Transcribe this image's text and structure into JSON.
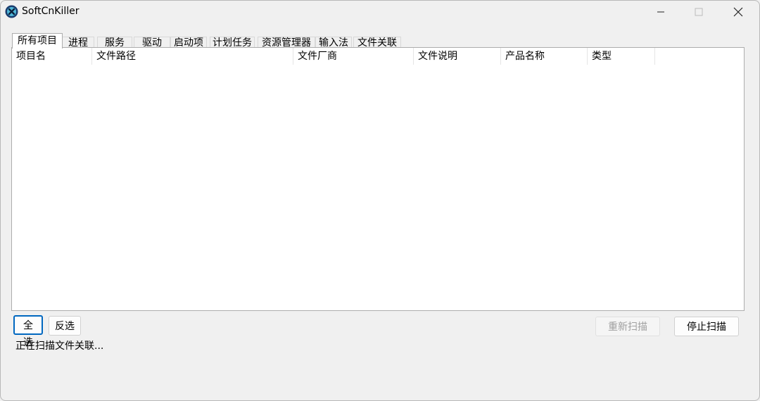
{
  "window": {
    "title": "SoftCnKiller",
    "controls": {
      "minimize": "—",
      "maximize": "☐",
      "close": "✕"
    }
  },
  "tabs": [
    {
      "label": "所有项目",
      "active": true
    },
    {
      "label": "进程"
    },
    {
      "label": "服务"
    },
    {
      "label": "驱动"
    },
    {
      "label": "启动项"
    },
    {
      "label": "计划任务"
    },
    {
      "label": "资源管理器"
    },
    {
      "label": "输入法"
    },
    {
      "label": "文件关联"
    }
  ],
  "table": {
    "columns": [
      "项目名",
      "文件路径",
      "文件厂商",
      "文件说明",
      "产品名称",
      "类型"
    ],
    "rows": []
  },
  "buttons": {
    "select_all": "全选",
    "invert": "反选",
    "rescan": "重新扫描",
    "stop_scan": "停止扫描"
  },
  "status": "正在扫描文件关联...",
  "colors": {
    "accent": "#0067c0",
    "icon_bg": "#1a3c6e",
    "icon_fg": "#ffffff"
  },
  "icons": {
    "app": "app-logo-icon"
  }
}
